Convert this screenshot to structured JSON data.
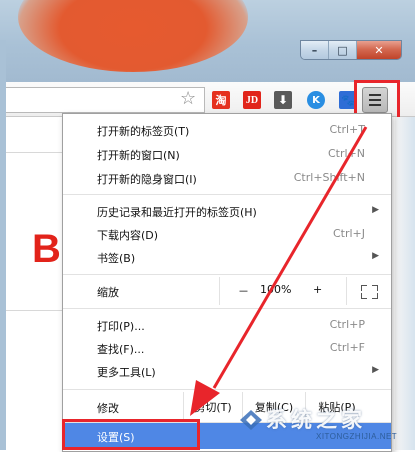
{
  "window": {
    "buttons": [
      "–",
      "□",
      "✕"
    ]
  },
  "toolbar": {
    "star_icon": "☆",
    "extensions": [
      {
        "name": "taobao-icon",
        "label": "淘"
      },
      {
        "name": "jd-icon",
        "label": "JD"
      },
      {
        "name": "download-icon",
        "label": "⬇"
      },
      {
        "name": "k-icon",
        "label": "K"
      },
      {
        "name": "baidu-paw-icon",
        "label": "🐾"
      }
    ]
  },
  "page": {
    "logo_letter": "B"
  },
  "menu": {
    "items": [
      {
        "label": "打开新的标签页(T)",
        "shortcut": "Ctrl+T"
      },
      {
        "label": "打开新的窗口(N)",
        "shortcut": "Ctrl+N"
      },
      {
        "label": "打开新的隐身窗口(I)",
        "shortcut": "Ctrl+Shift+N"
      },
      {
        "label": "历史记录和最近打开的标签页(H)",
        "shortcut": ""
      },
      {
        "label": "下载内容(D)",
        "shortcut": "Ctrl+J"
      },
      {
        "label": "书签(B)",
        "shortcut": ""
      },
      {
        "label": "打印(P)...",
        "shortcut": "Ctrl+P"
      },
      {
        "label": "查找(F)...",
        "shortcut": "Ctrl+F"
      },
      {
        "label": "更多工具(L)",
        "shortcut": ""
      }
    ],
    "zoom": {
      "label": "缩放",
      "minus": "－",
      "value": "100%",
      "plus": "+"
    },
    "edit": {
      "label": "修改",
      "cut": "剪切(T)",
      "copy": "复制(C)",
      "paste": "粘贴(P)"
    },
    "settings": {
      "label": "设置(S)"
    }
  },
  "watermark": {
    "text": "系统之家",
    "url": "XITONGZHIJIA.NET"
  },
  "colors": {
    "highlight_red": "#e8252b",
    "selected_blue": "#4f87e5",
    "logo_red": "#e2231a"
  }
}
